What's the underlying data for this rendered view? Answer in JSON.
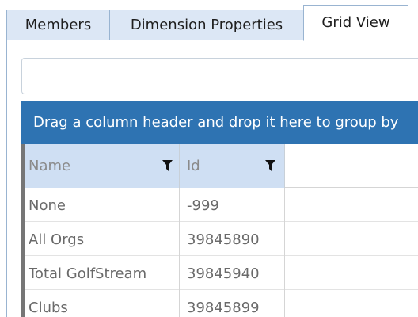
{
  "tabs": [
    {
      "label": "Members"
    },
    {
      "label": "Dimension Properties"
    },
    {
      "label": "Grid View",
      "selected": true
    }
  ],
  "search": {
    "value": "",
    "placeholder": ""
  },
  "group_panel": {
    "text": "Drag a column header and drop it here to group by"
  },
  "grid": {
    "columns": [
      {
        "label": "Name",
        "icon": "filter-icon"
      },
      {
        "label": "Id",
        "icon": "filter-icon"
      }
    ],
    "rows": [
      {
        "name": "None",
        "id": "-999"
      },
      {
        "name": "All Orgs",
        "id": "39845890"
      },
      {
        "name": "Total GolfStream",
        "id": "39845940"
      },
      {
        "name": "Clubs",
        "id": "39845899"
      }
    ]
  },
  "colors": {
    "accent": "#2e73b2",
    "header_bg": "#cfdff3",
    "tab_bg": "#dce7f5",
    "border": "#99b4d1"
  }
}
